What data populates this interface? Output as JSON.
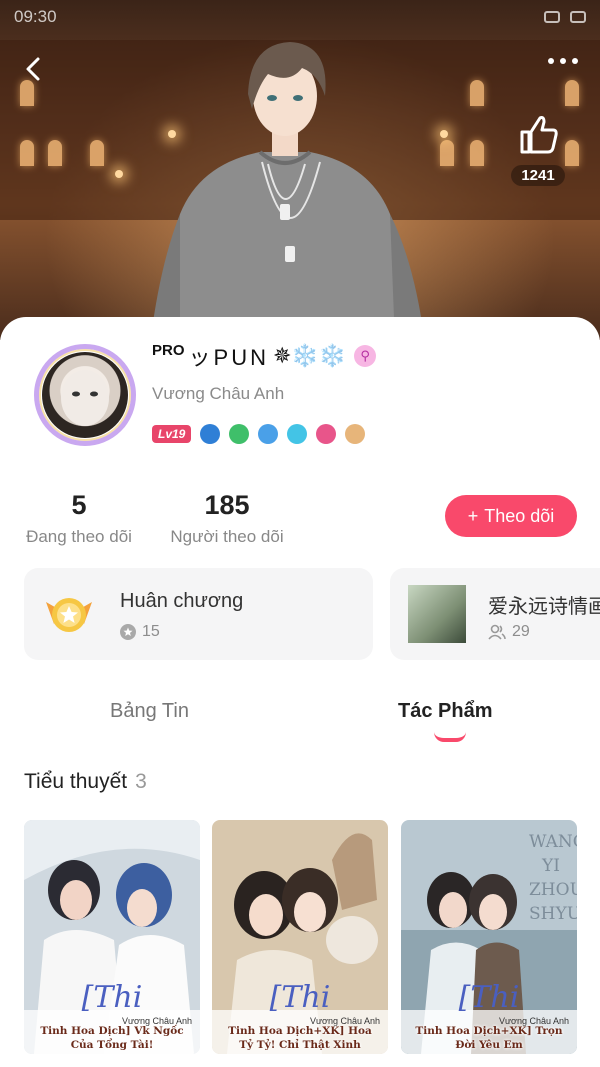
{
  "status_bar": {
    "time": "09:30"
  },
  "header": {
    "like_count": "1241"
  },
  "profile": {
    "name_prefix": "PRO",
    "name": "ッPUN",
    "name_suffix": "✵❄️❄️",
    "gender_symbol": "⚲",
    "real_name": "Vương Châu Anh",
    "level": "Lv19"
  },
  "stats": {
    "following_count": "5",
    "following_label": "Đang theo dõi",
    "followers_count": "185",
    "followers_label": "Người theo dõi"
  },
  "follow_button": {
    "icon": "+",
    "label": "Theo dõi"
  },
  "cards": {
    "medal": {
      "title": "Huân chương",
      "count": "15"
    },
    "group": {
      "title": "爱永远诗情画",
      "count": "29"
    }
  },
  "tabs": [
    {
      "label": "Bảng Tin",
      "active": false
    },
    {
      "label": "Tác Phẩm",
      "active": true
    }
  ],
  "section": {
    "title": "Tiểu thuyết",
    "count": "3"
  },
  "novels": [
    {
      "signature": "[Thi",
      "author": "Vương Châu Anh",
      "title_line1": "Tinh Hoa Dịch] Vk Ngốc",
      "title_line2": "Của Tổng Tài!"
    },
    {
      "signature": "[Thi",
      "author": "Vương Châu Anh",
      "title_line1": "Tinh Hoa Dịch+XK] Hoa",
      "title_line2": "Tỷ Tỷ! Chỉ Thật Xinh"
    },
    {
      "signature": "[Thi",
      "author": "Vương Châu Anh",
      "title_line1": "Tinh Hoa Dịch+XK] Trọn",
      "title_line2": "Đời Yêu Em"
    }
  ],
  "cover_text": {
    "novel3_side": "WANG YI ZHOU SHYU"
  },
  "colors": {
    "accent": "#f9496b",
    "level_badge": "#e8456a"
  }
}
